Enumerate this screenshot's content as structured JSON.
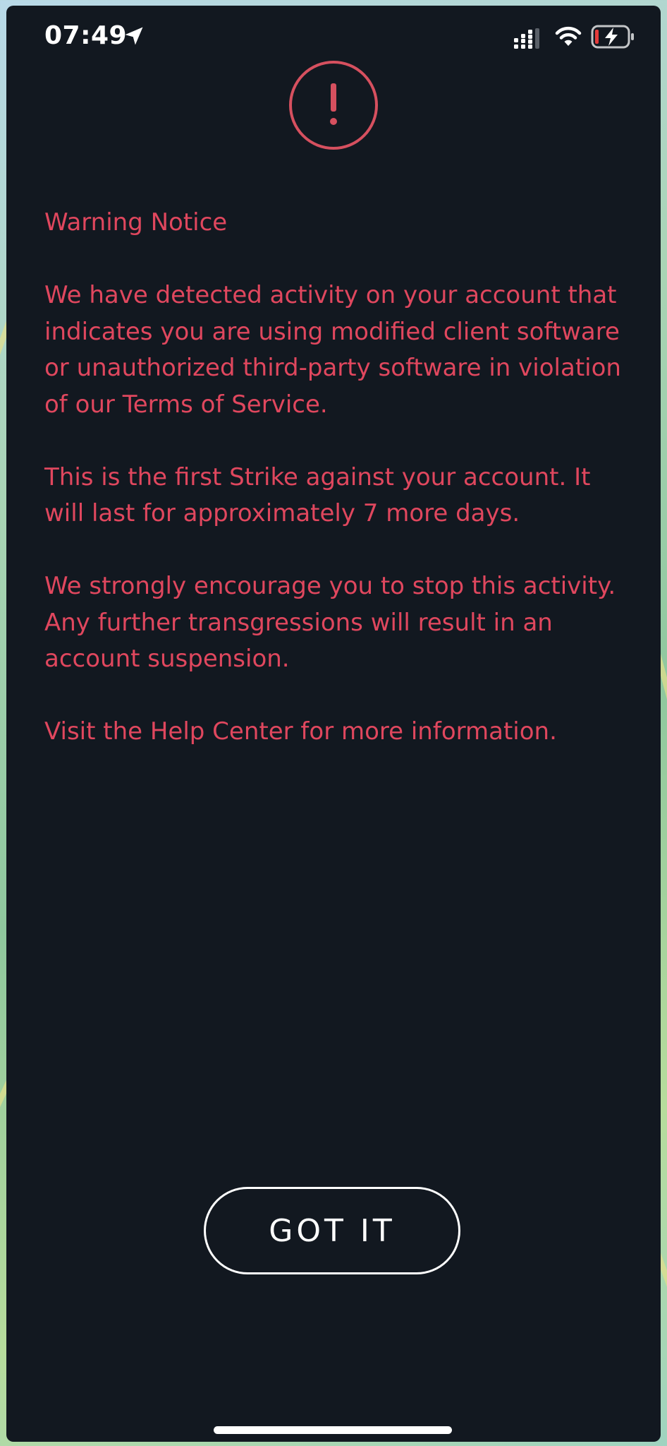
{
  "status_bar": {
    "time": "07:49",
    "icons": [
      "location-arrow-icon",
      "signal-icon",
      "wifi-icon",
      "battery-charging-icon"
    ]
  },
  "dialog": {
    "icon": "exclamation-circle-icon",
    "title": "Warning Notice",
    "paragraphs": [
      "We have detected activity on your account that indicates you are using modified client software or unauthorized third-party software in violation of our  Terms of Service.",
      "This is the first Strike against your account. It will last for approximately 7 more days.",
      "We strongly encourage you to stop this activity. Any further transgressions will result in an account suspension.",
      "Visit the Help Center  for more information."
    ],
    "button_label": "GOT IT"
  },
  "colors": {
    "panel_background": "#121820",
    "warning_text": "#e0475e",
    "button_border": "#ffffff"
  }
}
